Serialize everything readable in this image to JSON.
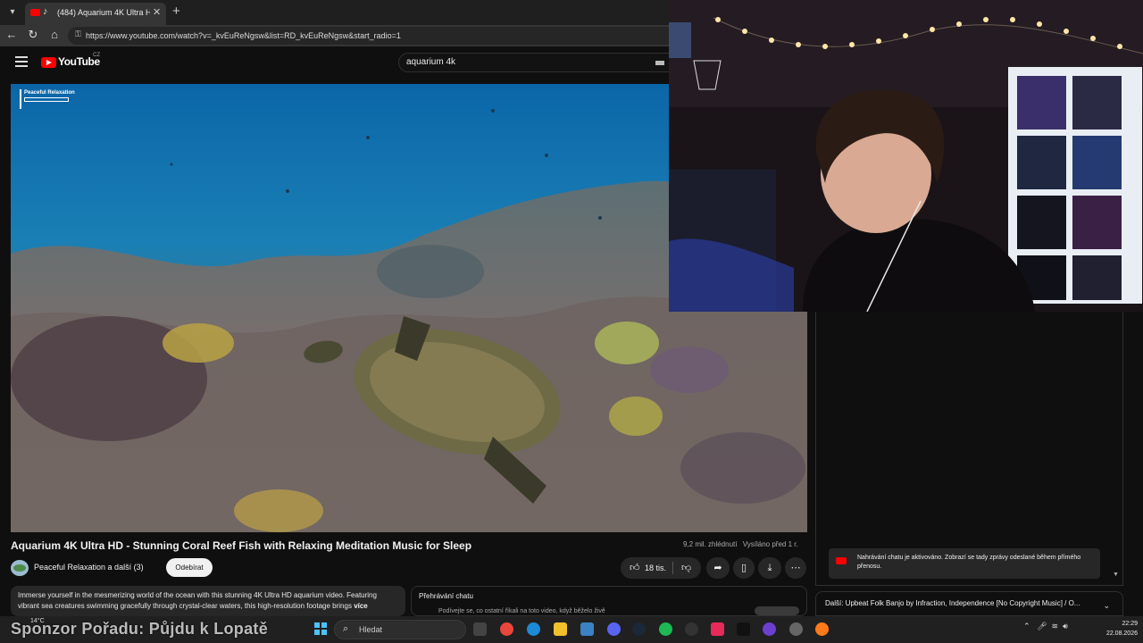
{
  "browser": {
    "tab_title": "(484) Aquarium 4K Ultra HD -",
    "new_tab": "+",
    "url": "https://www.youtube.com/watch?v=_kvEuReNgsw&list=RD_kvEuReNgsw&start_radio=1"
  },
  "youtube": {
    "logo_text": "YouTube",
    "country_code": "CZ",
    "search_value": "aquarium 4k"
  },
  "video": {
    "watermark_title": "Peaceful Relaxation",
    "title": "Aquarium 4K Ultra HD - Stunning Coral Reef Fish with Relaxing Meditation Music for Sleep",
    "views": "9,2 mil. zhlédnutí",
    "streamed": "Vysíláno před 1 r.",
    "channel": "Peaceful Relaxation a další (3)",
    "subscribe_label": "Odebírat",
    "likes": "18 tis.",
    "description": "Immerse yourself in the mesmerizing world of the ocean with this stunning 4K Ultra HD aquarium video. Featuring vibrant sea creatures swimming gracefully through crystal-clear waters, this high-resolution footage brings",
    "more_label": "více"
  },
  "chat": {
    "replay_heading": "Přehrávání chatu",
    "replay_sub": "Podívejte se, co ostatní říkali na toto video, když běželo živě",
    "notice": "Nahrávání chatu je aktivováno. Zobrazí se tady zprávy odeslané během přímého přenosu."
  },
  "next_up": "Další: Upbeat Folk Banjo by Infraction, Independence [No Copyright Music] / O...",
  "taskbar": {
    "weather": "14°C",
    "overlay_text": "Sponzor Pořadu: Půjdu k Lopatě",
    "search_placeholder": "Hledat",
    "time": "22:29",
    "date": "22.08.2026"
  }
}
